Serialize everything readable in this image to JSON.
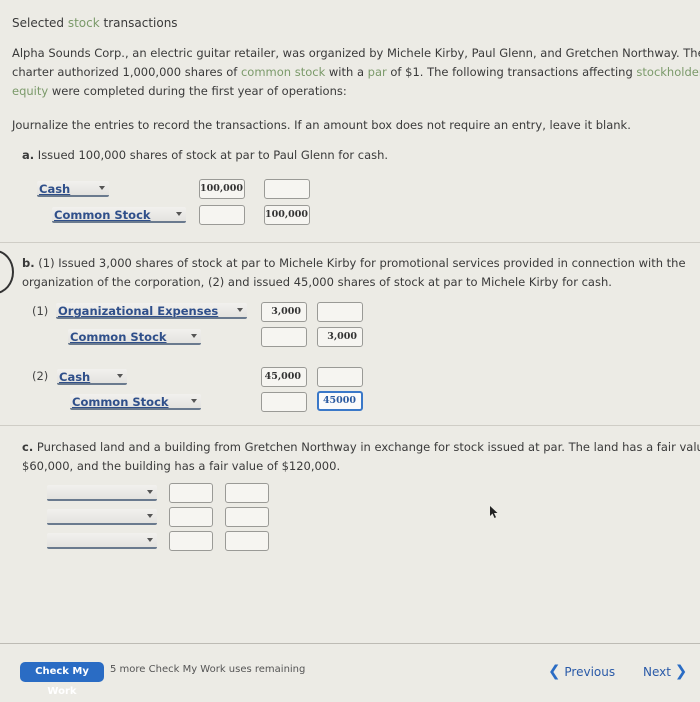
{
  "header": {
    "title_parts": [
      "Selected ",
      "stock",
      " transactions"
    ]
  },
  "intro": {
    "line1": "Alpha Sounds Corp., an electric guitar retailer, was organized by Michele Kirby, Paul Glenn, and Gretchen Northway. The",
    "line2_a": "charter authorized 1,000,000 shares of ",
    "line2_kw1": "common stock",
    "line2_b": " with a ",
    "line2_kw2": "par",
    "line2_c": " of $1. The following transactions affecting ",
    "line2_kw3": "stockholders'",
    "line3_kw": "equity",
    "line3_b": " were completed during the first year of operations:"
  },
  "instructions": "Journalize the entries to record the transactions. If an amount box does not require an entry, leave it blank.",
  "part_a": {
    "label": "a.",
    "text": " Issued 100,000 shares of stock at par to Paul Glenn for cash.",
    "rows": [
      {
        "account": "Cash",
        "debit": "100,000",
        "credit": ""
      },
      {
        "account": "Common Stock",
        "debit": "",
        "credit": "100,000"
      }
    ]
  },
  "part_b": {
    "label": "b.",
    "line1": " (1) Issued 3,000 shares of stock at par to Michele Kirby for promotional services provided in connection with the",
    "line2": "organization of the corporation, (2) and issued 45,000 shares of stock at par to Michele Kirby for cash.",
    "entry1_label": "(1)",
    "entry1_rows": [
      {
        "account": "Organizational Expenses",
        "debit": "3,000",
        "credit": ""
      },
      {
        "account": "Common Stock",
        "debit": "",
        "credit": "3,000"
      }
    ],
    "entry2_label": "(2)",
    "entry2_rows": [
      {
        "account": "Cash",
        "debit": "45,000",
        "credit": ""
      },
      {
        "account": "Common Stock",
        "debit": "",
        "credit": "45000"
      }
    ]
  },
  "part_c": {
    "label": "c.",
    "line1": " Purchased land and a building from Gretchen Northway in exchange for stock issued at par. The land has a fair value of",
    "line2": "$60,000, and the building has a fair value of $120,000.",
    "rows": [
      {
        "account": "",
        "debit": "",
        "credit": ""
      },
      {
        "account": "",
        "debit": "",
        "credit": ""
      },
      {
        "account": "",
        "debit": "",
        "credit": ""
      }
    ]
  },
  "footer": {
    "check_button": "Check My Work",
    "remaining": "5 more Check My Work uses remaining",
    "previous": "Previous",
    "next": "Next"
  },
  "colors": {
    "keyword": "#7b9a6a",
    "accent": "#2a6cc4",
    "account_text": "#2f4f8a"
  }
}
